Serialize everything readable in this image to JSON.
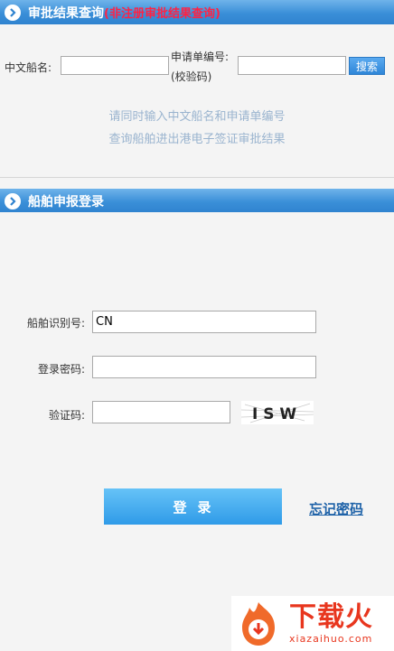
{
  "query": {
    "header_title": "审批结果查询",
    "header_note": "(非注册审批结果查询)",
    "ship_name_label": "中文船名:",
    "ship_name_value": "",
    "app_no_label": "申请单编号:",
    "app_no_sub": "(校验码)",
    "app_no_value": "",
    "search_label": "搜索",
    "hint_line1": "请同时输入中文船名和申请单编号",
    "hint_line2": "查询船舶进出港电子签证审批结果"
  },
  "login": {
    "header_title": "船舶申报登录",
    "ship_id_label": "船舶识别号:",
    "ship_id_value": "CN",
    "password_label": "登录密码:",
    "password_value": "",
    "captcha_label": "验证码:",
    "captcha_value": "",
    "captcha_text": "I S W",
    "login_label": "登录",
    "forgot_label": "忘记密码"
  },
  "watermark": {
    "brand_cn": "下载火",
    "brand_en": "xiazaihuo.com"
  },
  "colors": {
    "header_blue": "#3a8fd8",
    "red_note": "#ff2244",
    "hint": "#9ab4cf",
    "link": "#1e62a8",
    "brand": "#e8361e"
  }
}
